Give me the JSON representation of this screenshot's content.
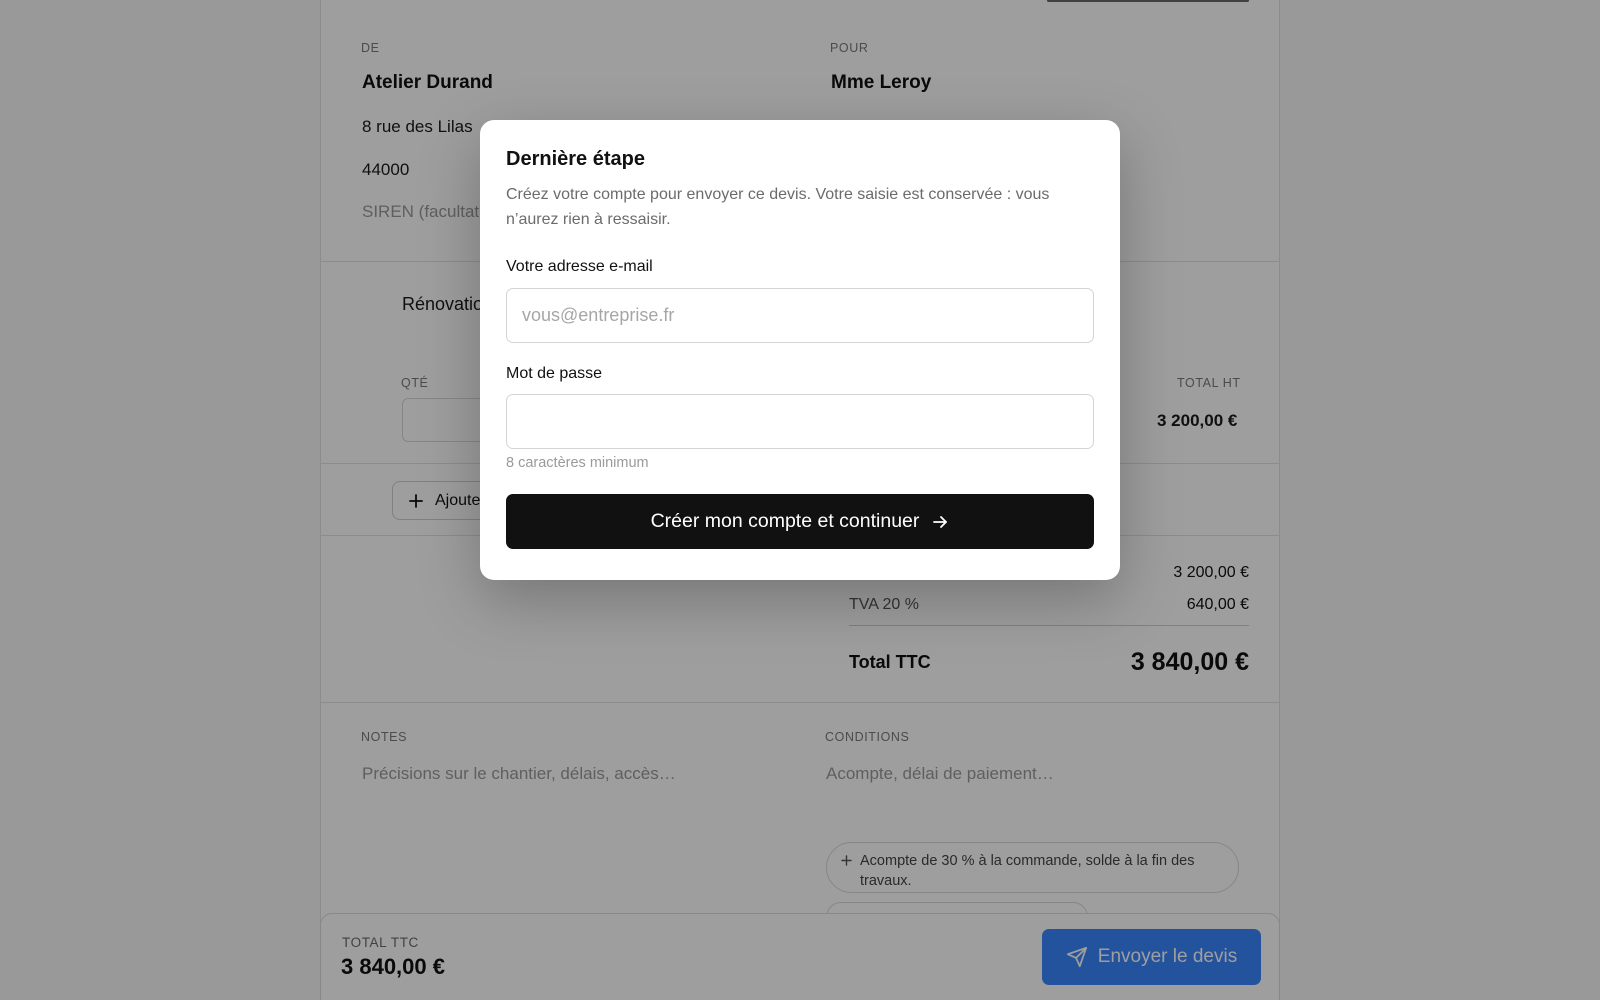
{
  "issuer": {
    "label": "DE",
    "name": "Atelier Durand",
    "address": "8 rue des Lilas",
    "postal_code": "44000",
    "siren_placeholder": "SIREN (facultat"
  },
  "client": {
    "label": "POUR",
    "name": "Mme Leroy"
  },
  "line_items": {
    "project_title": "Rénovatio",
    "qty_header": "QTÉ",
    "total_header": "TOTAL HT",
    "row_total": "3 200,00 €",
    "add_label": "Ajoute"
  },
  "totals": {
    "ht_value": "3 200,00 €",
    "tva_label": "TVA 20 %",
    "tva_value": "640,00 €",
    "ttc_label": "Total TTC",
    "ttc_value": "3 840,00 €"
  },
  "notes": {
    "label": "NOTES",
    "placeholder": "Précisions sur le chantier, délais, accès…"
  },
  "conditions": {
    "label": "CONDITIONS",
    "placeholder": "Acompte, délai de paiement…",
    "suggestion": "Acompte de 30 % à la commande, solde à la fin des travaux."
  },
  "bottom_bar": {
    "label": "TOTAL TTC",
    "amount": "3 840,00 €",
    "send_label": "Envoyer le devis"
  },
  "modal": {
    "title": "Dernière étape",
    "subtitle": "Créez votre compte pour envoyer ce devis. Votre saisie est conservée : vous n’aurez rien à ressaisir.",
    "email_label": "Votre adresse e-mail",
    "email_placeholder": "vous@entreprise.fr",
    "email_value": "",
    "password_label": "Mot de passe",
    "password_value": "",
    "password_hint": "8 caractères minimum",
    "cta_label": "Créer mon compte et continuer"
  },
  "colors": {
    "primary_button": "#3a86ff",
    "cta_button": "#111111"
  },
  "icons": {
    "add": "plus-icon",
    "send": "paper-plane-icon",
    "cta": "arrow-right-icon"
  }
}
